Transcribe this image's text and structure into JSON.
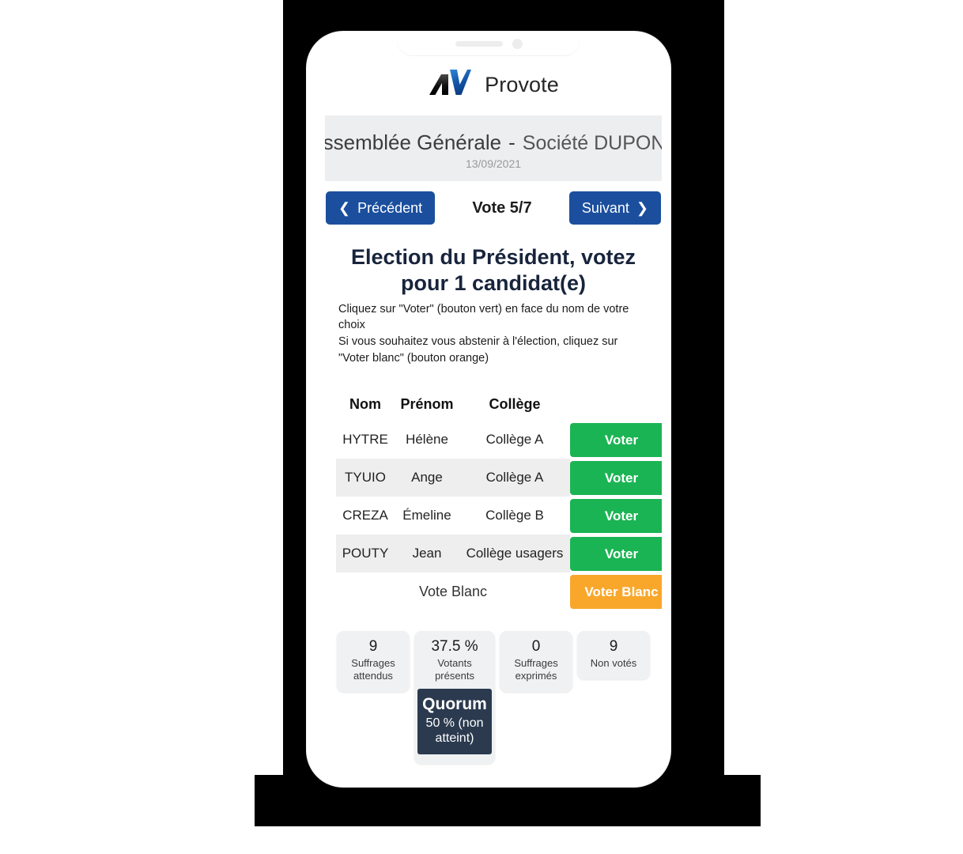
{
  "app": {
    "brand_name": "Provote",
    "logo_icon": "provote-av-logo-icon"
  },
  "meeting": {
    "assembly": "Assemblée Générale",
    "separator": "-",
    "company": "Société DUPONT",
    "date": "13/09/2021"
  },
  "nav": {
    "prev_label": "Précédent",
    "prev_icon": "chevron-left-icon",
    "next_label": "Suivant",
    "next_icon": "chevron-right-icon",
    "counter": "Vote 5/7",
    "button_color": "#1b4f9e"
  },
  "vote": {
    "title": "Election du Président, votez pour 1 candidat(e)",
    "instructions": "Cliquez sur \"Voter\" (bouton vert) en face du nom de votre choix\nSi vous souhaitez vous abstenir à l'élection, cliquez sur \"Voter blanc\" (bouton orange)"
  },
  "table": {
    "headers": {
      "nom": "Nom",
      "prenom": "Prénom",
      "college": "Collège",
      "action": ""
    },
    "vote_button_label": "Voter",
    "vote_button_color": "#1bb454",
    "blank_row_label": "Vote Blanc",
    "blank_button_label": "Voter Blanc",
    "blank_button_color": "#f9a72b",
    "rows": [
      {
        "nom": "HYTRE",
        "prenom": "Hélène",
        "college": "Collège A"
      },
      {
        "nom": "TYUIO",
        "prenom": "Ange",
        "college": "Collège A"
      },
      {
        "nom": "CREZA",
        "prenom": "Émeline",
        "college": "Collège B"
      },
      {
        "nom": "POUTY",
        "prenom": "Jean",
        "college": "Collège usagers"
      }
    ]
  },
  "stats": [
    {
      "value": "9",
      "label": "Suffrages attendus"
    },
    {
      "value": "37.5 %",
      "label": "Votants présents"
    },
    {
      "value": "0",
      "label": "Suffrages exprimés"
    },
    {
      "value": "9",
      "label": "Non votés"
    }
  ],
  "quorum": {
    "title": "Quorum",
    "detail": "50 % (non atteint)",
    "background": "#2b3a4f"
  }
}
